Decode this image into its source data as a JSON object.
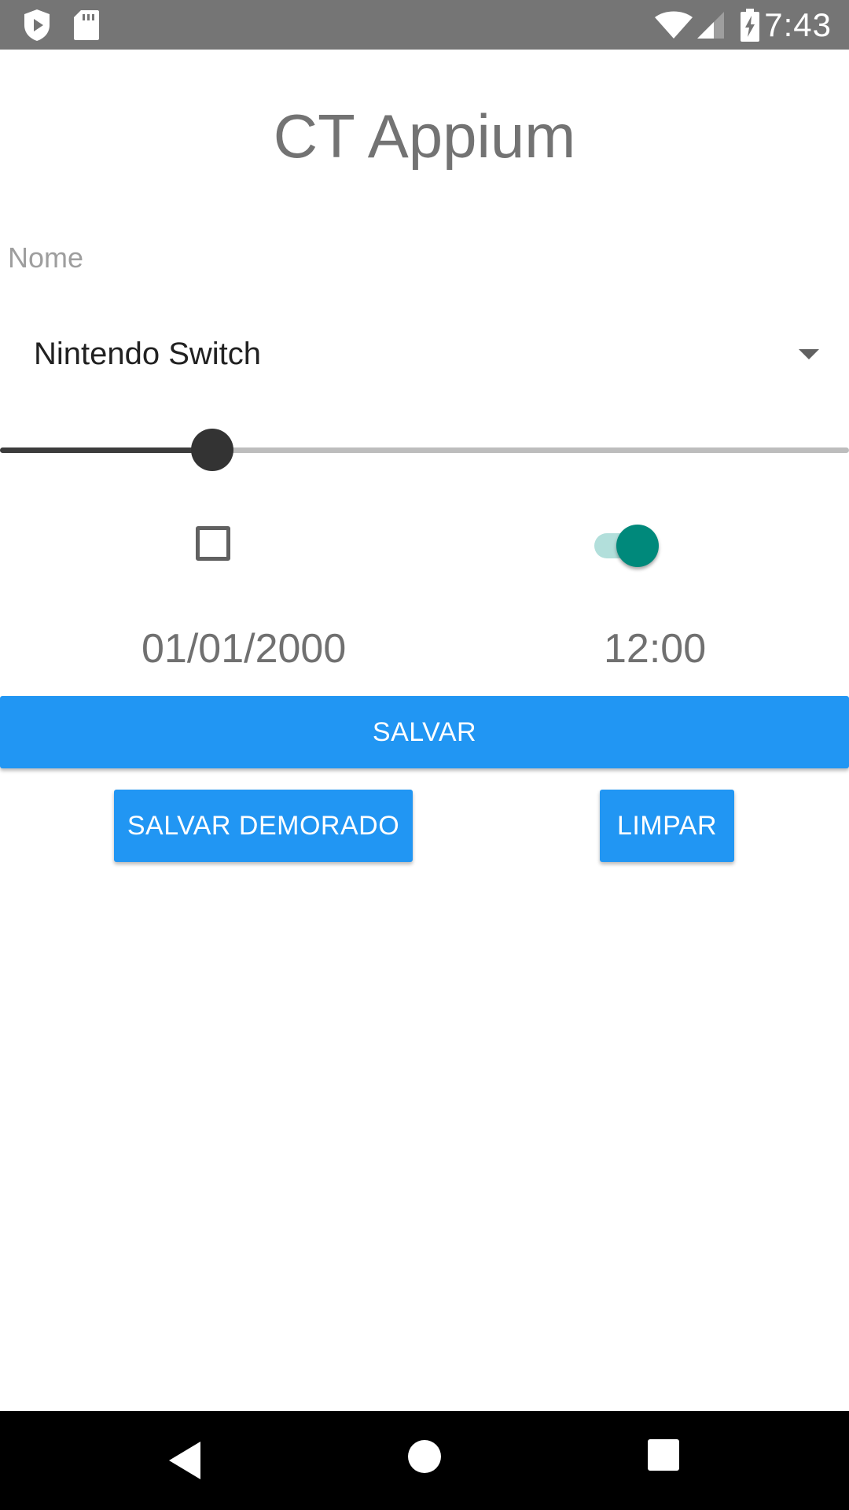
{
  "status_bar": {
    "time": "7:43",
    "icons": [
      "shield-play-icon",
      "sd-card-icon",
      "wifi-icon",
      "signal-icon",
      "battery-charging-icon"
    ]
  },
  "app": {
    "title": "CT Appium"
  },
  "form": {
    "name_placeholder": "Nome",
    "name_value": "",
    "console_selected": "Nintendo Switch",
    "slider_fraction": 0.25,
    "checkbox_checked": false,
    "switch_on": true,
    "date": "01/01/2000",
    "time": "12:00"
  },
  "buttons": {
    "save": "SALVAR",
    "save_delayed": "SALVAR DEMORADO",
    "clear": "LIMPAR"
  },
  "nav_bar": {
    "icons": [
      "back-icon",
      "home-icon",
      "recents-icon"
    ]
  },
  "colors": {
    "primary": "#2196f3",
    "accent": "#00897b",
    "status_bar": "#757575"
  }
}
